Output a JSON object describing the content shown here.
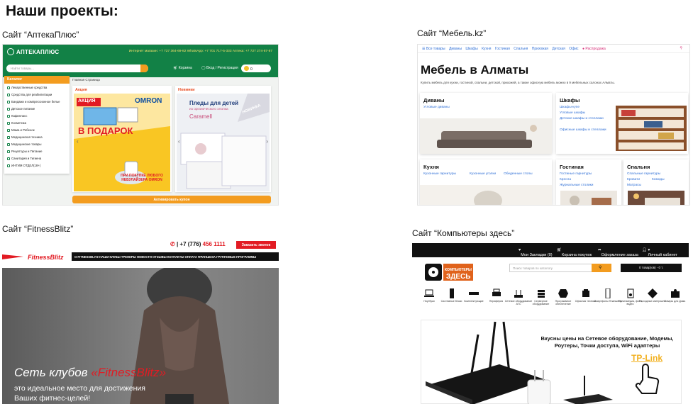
{
  "page_title": "Наши проекты:",
  "projects": {
    "apteka": {
      "caption": "Сайт “АптекаПлюс”",
      "logo": "АПТЕКАПЛЮС",
      "phones": "Интернет магазин: +7 727 364-69-82   WhatsApp: +7 701 717-5-333   Аптека: +7 727 274-87-87",
      "search_placeholder": "Найти товары...",
      "cart": "Корзина",
      "login": "Вход / Регистрация",
      "sum": "0",
      "catalog": "Каталог",
      "home": "Главная Страница",
      "menu": [
        "Лекарственные средства",
        "Средства для реабилитации",
        "Бандажи и компрессионное белье",
        "Детское питание",
        "Кафипласс",
        "Косметика",
        "Мама и Ребенок",
        "Медицинская техника",
        "Медицинские товары",
        "Рецептуры и Питание",
        "Санитария и Гигиена",
        "ИНТИМ ОТДЕЛ(18+)"
      ],
      "promo_label": "Акция",
      "new_label": "Новинки",
      "promo": {
        "badge": "АКЦИЯ",
        "brand": "OMRON",
        "gift": "В ПОДАРОК",
        "bottom": "ПРИ ПОКУПКЕ ЛЮБОГО НЕБУЛАЙЗЕРА OMRON"
      },
      "new": {
        "title": "Пледы для детей",
        "sub": "из органического хлопка",
        "brand": "Caramell",
        "badge": "НОВИНКА"
      },
      "button": "Активировать купон"
    },
    "mebel": {
      "caption": "Сайт “Мебель.kz”",
      "nav": [
        "☰ Все товары",
        "Диваны",
        "Шкафы",
        "Кухня",
        "Гостиная",
        "Спальня",
        "Прихожая",
        "Детская",
        "Офис",
        "● Распродажа"
      ],
      "heading": "Мебель в Алматы",
      "subtitle": "Купить мебель для кухни, гостиной, спальни, детской, прихожей, а также офисную мебель можно в 9 мебельных салонах Алматы.",
      "cards": [
        {
          "title": "Диваны",
          "links": [
            "Угловые диваны"
          ]
        },
        {
          "title": "Шкафы",
          "links": [
            "Шкафы-купе",
            "Угловые шкафы",
            "Детские шкафы и стеллажи",
            "Офисные шкафы и стеллажи"
          ]
        },
        {
          "title": "Кухня",
          "links": [
            "Кухонные гарнитуры",
            "Кухонные уголки",
            "Обеденные столы"
          ]
        },
        {
          "title": "Гостиная",
          "links": [
            "Гостиные гарнитуры",
            "Кресла",
            "Журнальные столики"
          ]
        },
        {
          "title": "Спальня",
          "links": [
            "Спальные гарнитуры",
            "Кровати",
            "Комоды",
            "Матрасы"
          ]
        }
      ]
    },
    "fitness": {
      "caption": "Сайт “FitnessBlitz”",
      "phone_prefix": "| +7 (776)",
      "phone_main": "456 1111",
      "call_button": "Заказать звонок",
      "logo": "FitnessBlitz",
      "nav": "О FITNESSBLITZ   НАШИ КЛУБЫ   ТРЕНЕРЫ   НОВОСТИ   ОТЗЫВЫ   КОНТАКТЫ   ОПЛАТА   ФРАНШИЗА   ГРУППОВЫЕ ПРОГРАММЫ",
      "hero_title_a": "Сеть клубов ",
      "hero_title_b": "«FitnessBlitz»",
      "hero_line1": "это идеальное место для достижения",
      "hero_line2": "Ваших фитнес-целей!"
    },
    "computers": {
      "caption": "Сайт “Компьютеры здесь”",
      "top_links": [
        "Мои Закладки (0)",
        "Корзина покупок",
        "Оформление заказа",
        "Личный кабинет"
      ],
      "logo": "КОМПЬЮТЕРЫ ЗДЕСЬ",
      "search_placeholder": "Поиск товаров по каталогу",
      "cart": "0 товар(ов) - 0 т.",
      "categories": [
        {
          "label": "Ноутбуки",
          "icon": "laptop-icon"
        },
        {
          "label": "Системные блоки",
          "icon": "tower-icon"
        },
        {
          "label": "Комплектующие",
          "icon": "component-icon"
        },
        {
          "label": "Периферия",
          "icon": "printer-icon"
        },
        {
          "label": "Сетевое оборудование АТС",
          "icon": "router-icon"
        },
        {
          "label": "Серверное оборудование",
          "icon": "server-icon"
        },
        {
          "label": "Программное обеспечение",
          "icon": "software-icon"
        },
        {
          "label": "Офисная техника",
          "icon": "office-icon"
        },
        {
          "label": "Смартфоны Планшеты",
          "icon": "phone-icon"
        },
        {
          "label": "Мультимедиа, фото, видео",
          "icon": "media-icon"
        },
        {
          "label": "Расходные материалы",
          "icon": "consumables-icon"
        },
        {
          "label": "Товары для Дома",
          "icon": "home-goods-icon"
        }
      ],
      "banner_text": "Вкусны цены на Сетевое оборудование, Модемы, Роутеры, Точки доступа, WiFi адаптеры",
      "brand": "TP-Link"
    }
  }
}
